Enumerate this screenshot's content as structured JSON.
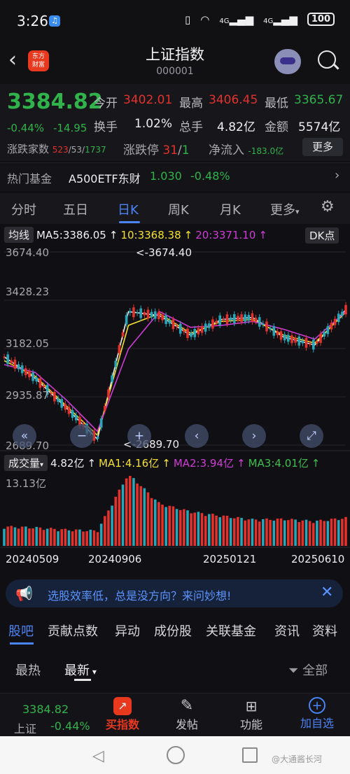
{
  "status_bar": {
    "time": "3:26",
    "app_icon": "app-square-icon",
    "network1": "4G",
    "network2": "4G",
    "battery": "100"
  },
  "header": {
    "title": "上证指数",
    "code": "000001",
    "logo_text_1": "东方",
    "logo_text_2": "财富"
  },
  "quote": {
    "price": "3384.82",
    "change_pct": "-0.44%",
    "change_abs": "-14.95",
    "open_label": "今开",
    "open": "3402.01",
    "high_label": "最高",
    "high": "3406.45",
    "low_label": "最低",
    "low": "3365.67",
    "turnover_label": "换手",
    "turnover": "1.02%",
    "volume_label": "总手",
    "volume": "4.82亿",
    "amount_label": "金额",
    "amount": "5574亿",
    "updown_label": "涨跌家数",
    "up_count": "523",
    "flat_count": "53",
    "down_count": "1737",
    "limit_label": "涨跌停",
    "limit_up": "31",
    "limit_down": "1",
    "netflow_label": "净流入",
    "netflow": "-183.0亿",
    "more_label": "更多"
  },
  "fund": {
    "label": "热门基金",
    "name": "A500ETF东财",
    "price": "1.030",
    "pct": "-0.48%"
  },
  "tabs": [
    {
      "label": "分时"
    },
    {
      "label": "五日"
    },
    {
      "label": "日K"
    },
    {
      "label": "周K"
    },
    {
      "label": "月K"
    },
    {
      "label": "更多"
    }
  ],
  "chart_header": {
    "mode": "均线",
    "ma5": "MA5:3386.05",
    "ma10": "10:3368.38",
    "ma20": "20:3371.10",
    "dk": "DK点"
  },
  "chart_axes": {
    "y_labels": [
      "3674.40",
      "3428.23",
      "3182.05",
      "2935.87",
      "2689.70"
    ],
    "max_label": "<-3674.40",
    "min_label": "<-2689.70"
  },
  "volume_header": {
    "label": "成交量",
    "vol": "4.82亿",
    "ma1": "MA1:4.16亿",
    "ma2": "MA2:3.94亿",
    "ma3": "MA3:4.01亿",
    "max": "13.13亿"
  },
  "dates": [
    "20240509",
    "20240906",
    "20250121",
    "20250610"
  ],
  "colors": {
    "up": "#e3322c",
    "down": "#2fb34a",
    "accent": "#4a84f5",
    "ma5": "#f2f2f2",
    "ma10": "#f5e12a",
    "ma20": "#d03ad6",
    "vol_ma3": "#3fbf4f"
  },
  "chart_data": {
    "type": "line",
    "title": "",
    "xlabel": "",
    "ylabel": "",
    "ylim": [
      2689.7,
      3674.4
    ],
    "x": [
      "20240509",
      "20240906",
      "20250121",
      "20250610"
    ],
    "series": [
      {
        "name": "MA5",
        "values": [
          3140,
          3030,
          2880,
          2720,
          3370,
          3350,
          3250,
          3330,
          3340,
          3240,
          3200,
          3380
        ]
      },
      {
        "name": "MA10",
        "values": [
          3120,
          3040,
          2890,
          2740,
          3300,
          3360,
          3260,
          3320,
          3330,
          3250,
          3210,
          3368
        ]
      },
      {
        "name": "MA20",
        "values": [
          3100,
          3060,
          2920,
          2760,
          3180,
          3370,
          3290,
          3300,
          3320,
          3280,
          3230,
          3371
        ]
      }
    ],
    "volume": [
      3.2,
      3.0,
      2.6,
      2.4,
      13.13,
      7.5,
      6.0,
      5.2,
      4.5,
      4.6,
      4.2,
      4.82
    ]
  },
  "promo": {
    "text": "选股效率低，总是没方向？来问妙想!"
  },
  "bottom_tabs": [
    {
      "label": "股吧"
    },
    {
      "label": "贡献点数"
    },
    {
      "label": "异动"
    },
    {
      "label": "成份股"
    },
    {
      "label": "关联基金"
    },
    {
      "label": "资讯"
    },
    {
      "label": "资料"
    }
  ],
  "sort": {
    "hot": "最热",
    "latest": "最新",
    "filter": "全部"
  },
  "bottom_nav": {
    "price": "3384.82",
    "name": "上证",
    "pct": "-0.44%",
    "buy": "买指数",
    "post": "发帖",
    "func": "功能",
    "add": "加自选"
  },
  "watermark": "@大通酱长河"
}
